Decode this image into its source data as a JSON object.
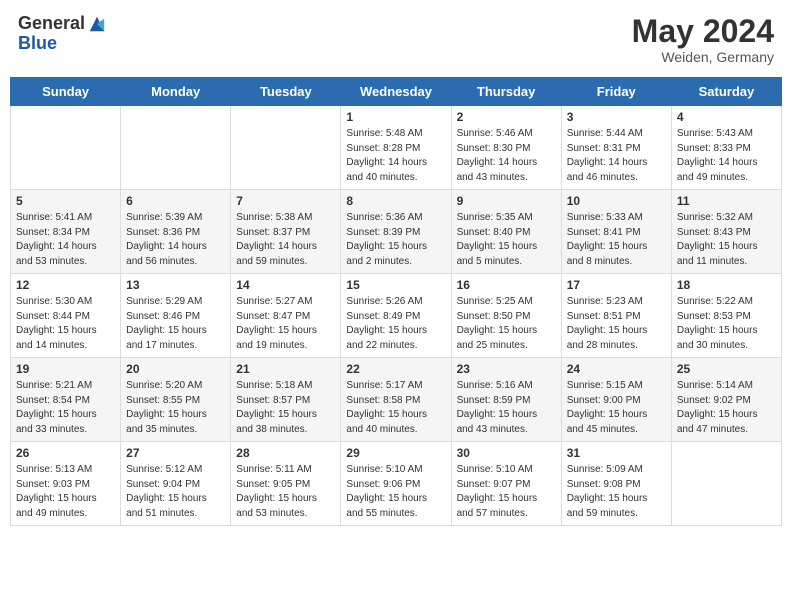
{
  "header": {
    "logo_general": "General",
    "logo_blue": "Blue",
    "month_year": "May 2024",
    "location": "Weiden, Germany"
  },
  "weekdays": [
    "Sunday",
    "Monday",
    "Tuesday",
    "Wednesday",
    "Thursday",
    "Friday",
    "Saturday"
  ],
  "weeks": [
    [
      {
        "day": "",
        "info": ""
      },
      {
        "day": "",
        "info": ""
      },
      {
        "day": "",
        "info": ""
      },
      {
        "day": "1",
        "info": "Sunrise: 5:48 AM\nSunset: 8:28 PM\nDaylight: 14 hours\nand 40 minutes."
      },
      {
        "day": "2",
        "info": "Sunrise: 5:46 AM\nSunset: 8:30 PM\nDaylight: 14 hours\nand 43 minutes."
      },
      {
        "day": "3",
        "info": "Sunrise: 5:44 AM\nSunset: 8:31 PM\nDaylight: 14 hours\nand 46 minutes."
      },
      {
        "day": "4",
        "info": "Sunrise: 5:43 AM\nSunset: 8:33 PM\nDaylight: 14 hours\nand 49 minutes."
      }
    ],
    [
      {
        "day": "5",
        "info": "Sunrise: 5:41 AM\nSunset: 8:34 PM\nDaylight: 14 hours\nand 53 minutes."
      },
      {
        "day": "6",
        "info": "Sunrise: 5:39 AM\nSunset: 8:36 PM\nDaylight: 14 hours\nand 56 minutes."
      },
      {
        "day": "7",
        "info": "Sunrise: 5:38 AM\nSunset: 8:37 PM\nDaylight: 14 hours\nand 59 minutes."
      },
      {
        "day": "8",
        "info": "Sunrise: 5:36 AM\nSunset: 8:39 PM\nDaylight: 15 hours\nand 2 minutes."
      },
      {
        "day": "9",
        "info": "Sunrise: 5:35 AM\nSunset: 8:40 PM\nDaylight: 15 hours\nand 5 minutes."
      },
      {
        "day": "10",
        "info": "Sunrise: 5:33 AM\nSunset: 8:41 PM\nDaylight: 15 hours\nand 8 minutes."
      },
      {
        "day": "11",
        "info": "Sunrise: 5:32 AM\nSunset: 8:43 PM\nDaylight: 15 hours\nand 11 minutes."
      }
    ],
    [
      {
        "day": "12",
        "info": "Sunrise: 5:30 AM\nSunset: 8:44 PM\nDaylight: 15 hours\nand 14 minutes."
      },
      {
        "day": "13",
        "info": "Sunrise: 5:29 AM\nSunset: 8:46 PM\nDaylight: 15 hours\nand 17 minutes."
      },
      {
        "day": "14",
        "info": "Sunrise: 5:27 AM\nSunset: 8:47 PM\nDaylight: 15 hours\nand 19 minutes."
      },
      {
        "day": "15",
        "info": "Sunrise: 5:26 AM\nSunset: 8:49 PM\nDaylight: 15 hours\nand 22 minutes."
      },
      {
        "day": "16",
        "info": "Sunrise: 5:25 AM\nSunset: 8:50 PM\nDaylight: 15 hours\nand 25 minutes."
      },
      {
        "day": "17",
        "info": "Sunrise: 5:23 AM\nSunset: 8:51 PM\nDaylight: 15 hours\nand 28 minutes."
      },
      {
        "day": "18",
        "info": "Sunrise: 5:22 AM\nSunset: 8:53 PM\nDaylight: 15 hours\nand 30 minutes."
      }
    ],
    [
      {
        "day": "19",
        "info": "Sunrise: 5:21 AM\nSunset: 8:54 PM\nDaylight: 15 hours\nand 33 minutes."
      },
      {
        "day": "20",
        "info": "Sunrise: 5:20 AM\nSunset: 8:55 PM\nDaylight: 15 hours\nand 35 minutes."
      },
      {
        "day": "21",
        "info": "Sunrise: 5:18 AM\nSunset: 8:57 PM\nDaylight: 15 hours\nand 38 minutes."
      },
      {
        "day": "22",
        "info": "Sunrise: 5:17 AM\nSunset: 8:58 PM\nDaylight: 15 hours\nand 40 minutes."
      },
      {
        "day": "23",
        "info": "Sunrise: 5:16 AM\nSunset: 8:59 PM\nDaylight: 15 hours\nand 43 minutes."
      },
      {
        "day": "24",
        "info": "Sunrise: 5:15 AM\nSunset: 9:00 PM\nDaylight: 15 hours\nand 45 minutes."
      },
      {
        "day": "25",
        "info": "Sunrise: 5:14 AM\nSunset: 9:02 PM\nDaylight: 15 hours\nand 47 minutes."
      }
    ],
    [
      {
        "day": "26",
        "info": "Sunrise: 5:13 AM\nSunset: 9:03 PM\nDaylight: 15 hours\nand 49 minutes."
      },
      {
        "day": "27",
        "info": "Sunrise: 5:12 AM\nSunset: 9:04 PM\nDaylight: 15 hours\nand 51 minutes."
      },
      {
        "day": "28",
        "info": "Sunrise: 5:11 AM\nSunset: 9:05 PM\nDaylight: 15 hours\nand 53 minutes."
      },
      {
        "day": "29",
        "info": "Sunrise: 5:10 AM\nSunset: 9:06 PM\nDaylight: 15 hours\nand 55 minutes."
      },
      {
        "day": "30",
        "info": "Sunrise: 5:10 AM\nSunset: 9:07 PM\nDaylight: 15 hours\nand 57 minutes."
      },
      {
        "day": "31",
        "info": "Sunrise: 5:09 AM\nSunset: 9:08 PM\nDaylight: 15 hours\nand 59 minutes."
      },
      {
        "day": "",
        "info": ""
      }
    ]
  ]
}
